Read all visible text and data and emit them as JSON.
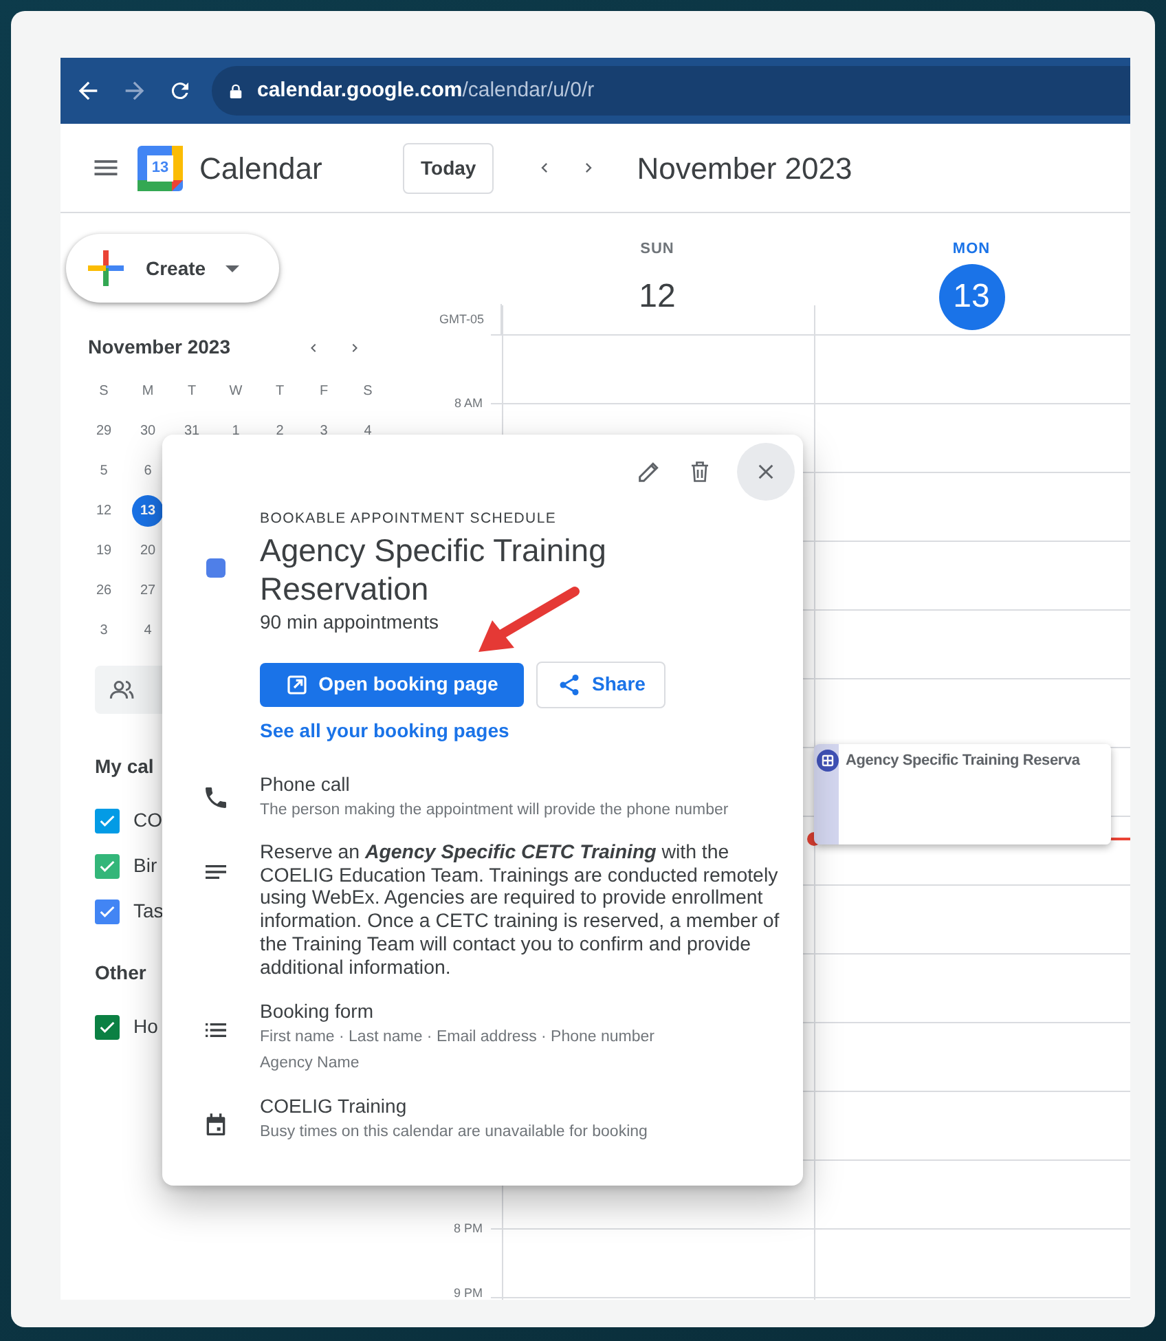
{
  "browser": {
    "url_host": "calendar.google.com",
    "url_path": "/calendar/u/0/r"
  },
  "header": {
    "logo_day": "13",
    "app_name": "Calendar",
    "today_button": "Today",
    "period": "November 2023"
  },
  "sidebar": {
    "create_button": "Create",
    "mini_calendar": {
      "title": "November 2023",
      "weekdays": [
        "S",
        "M",
        "T",
        "W",
        "T",
        "F",
        "S"
      ],
      "weeks": [
        [
          {
            "day": "29",
            "selected": false
          },
          {
            "day": "30",
            "selected": false
          },
          {
            "day": "31",
            "selected": false
          },
          {
            "day": "1",
            "selected": false
          },
          {
            "day": "2",
            "selected": false
          },
          {
            "day": "3",
            "selected": false
          },
          {
            "day": "4",
            "selected": false
          }
        ],
        [
          {
            "day": "5",
            "selected": false
          },
          {
            "day": "6",
            "selected": false
          }
        ],
        [
          {
            "day": "12",
            "selected": false
          },
          {
            "day": "13",
            "selected": true
          }
        ],
        [
          {
            "day": "19",
            "selected": false
          },
          {
            "day": "20",
            "selected": false
          }
        ],
        [
          {
            "day": "26",
            "selected": false
          },
          {
            "day": "27",
            "selected": false
          }
        ],
        [
          {
            "day": "3",
            "selected": false
          },
          {
            "day": "4",
            "selected": false
          }
        ]
      ]
    },
    "sections": [
      {
        "title": "My cal",
        "calendars": [
          {
            "label": "CO",
            "checked": true,
            "color": "#039be5"
          },
          {
            "label": "Bir",
            "checked": true,
            "color": "#33b679"
          },
          {
            "label": "Tas",
            "checked": true,
            "color": "#4285f4"
          }
        ]
      },
      {
        "title": "Other",
        "calendars": [
          {
            "label": "Ho",
            "checked": true,
            "color": "#0b8043"
          }
        ]
      }
    ]
  },
  "grid": {
    "timezone": "GMT-05",
    "days": [
      {
        "weekday": "SUN",
        "date": "12",
        "today": false
      },
      {
        "weekday": "MON",
        "date": "13",
        "today": true
      }
    ],
    "time_labels": [
      "8 AM",
      "8 PM",
      "9 PM"
    ],
    "event": {
      "title": "Agency Specific Training Reserva"
    }
  },
  "popup": {
    "kind_label": "BOOKABLE APPOINTMENT SCHEDULE",
    "title": "Agency Specific Training Reservation",
    "subtitle": "90 min appointments",
    "primary_button": "Open booking page",
    "share_button": "Share",
    "link": "See all your booking pages",
    "details": [
      {
        "kind": "phone",
        "title": "Phone call",
        "lines": [
          "The person making the appointment will provide the phone number"
        ]
      },
      {
        "kind": "description",
        "text": "Reserve an **Agency Specific CETC Training** with the COELIG Education Team.  Trainings are conducted remotely using WebEx. Agencies are required to provide enrollment information. Once a CETC training is reserved, a member of the Training Team will contact you to confirm and provide additional information."
      },
      {
        "kind": "form",
        "title": "Booking form",
        "lines": [
          "First name · Last name · Email address · Phone number",
          "Agency Name"
        ]
      },
      {
        "kind": "calendar",
        "title": "COELIG Training",
        "lines": [
          "Busy times on this calendar are unavailable for booking"
        ]
      }
    ]
  }
}
